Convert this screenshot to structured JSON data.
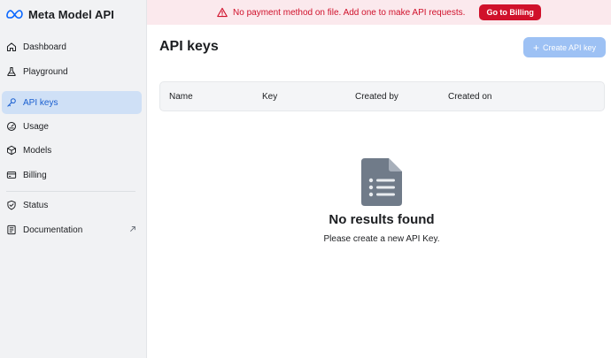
{
  "brand": {
    "name": "Meta Model API"
  },
  "sidebar": {
    "items": [
      {
        "label": "Dashboard",
        "icon": "home-icon"
      },
      {
        "label": "Playground",
        "icon": "flask-icon"
      },
      {
        "label": "API keys",
        "icon": "key-icon",
        "active": true
      },
      {
        "label": "Usage",
        "icon": "gauge-icon"
      },
      {
        "label": "Models",
        "icon": "cube-icon"
      },
      {
        "label": "Billing",
        "icon": "credit-card-icon"
      },
      {
        "label": "Status",
        "icon": "shield-icon"
      },
      {
        "label": "Documentation",
        "icon": "document-icon",
        "external": true
      }
    ]
  },
  "banner": {
    "message": "No payment method on file. Add one to make API requests.",
    "button_label": "Go to Billing"
  },
  "main": {
    "title": "API keys",
    "create_button_label": "Create API key",
    "table": {
      "columns": [
        "Name",
        "Key",
        "Created by",
        "Created on"
      ]
    },
    "empty": {
      "title": "No results found",
      "subtitle": "Please create a new API Key."
    }
  },
  "colors": {
    "accent": "#1a5fd0",
    "active_bg": "#cfe0f6",
    "danger": "#d0112b",
    "banner_bg": "#fbe9ed",
    "create_button_bg": "#9dc1f4"
  }
}
